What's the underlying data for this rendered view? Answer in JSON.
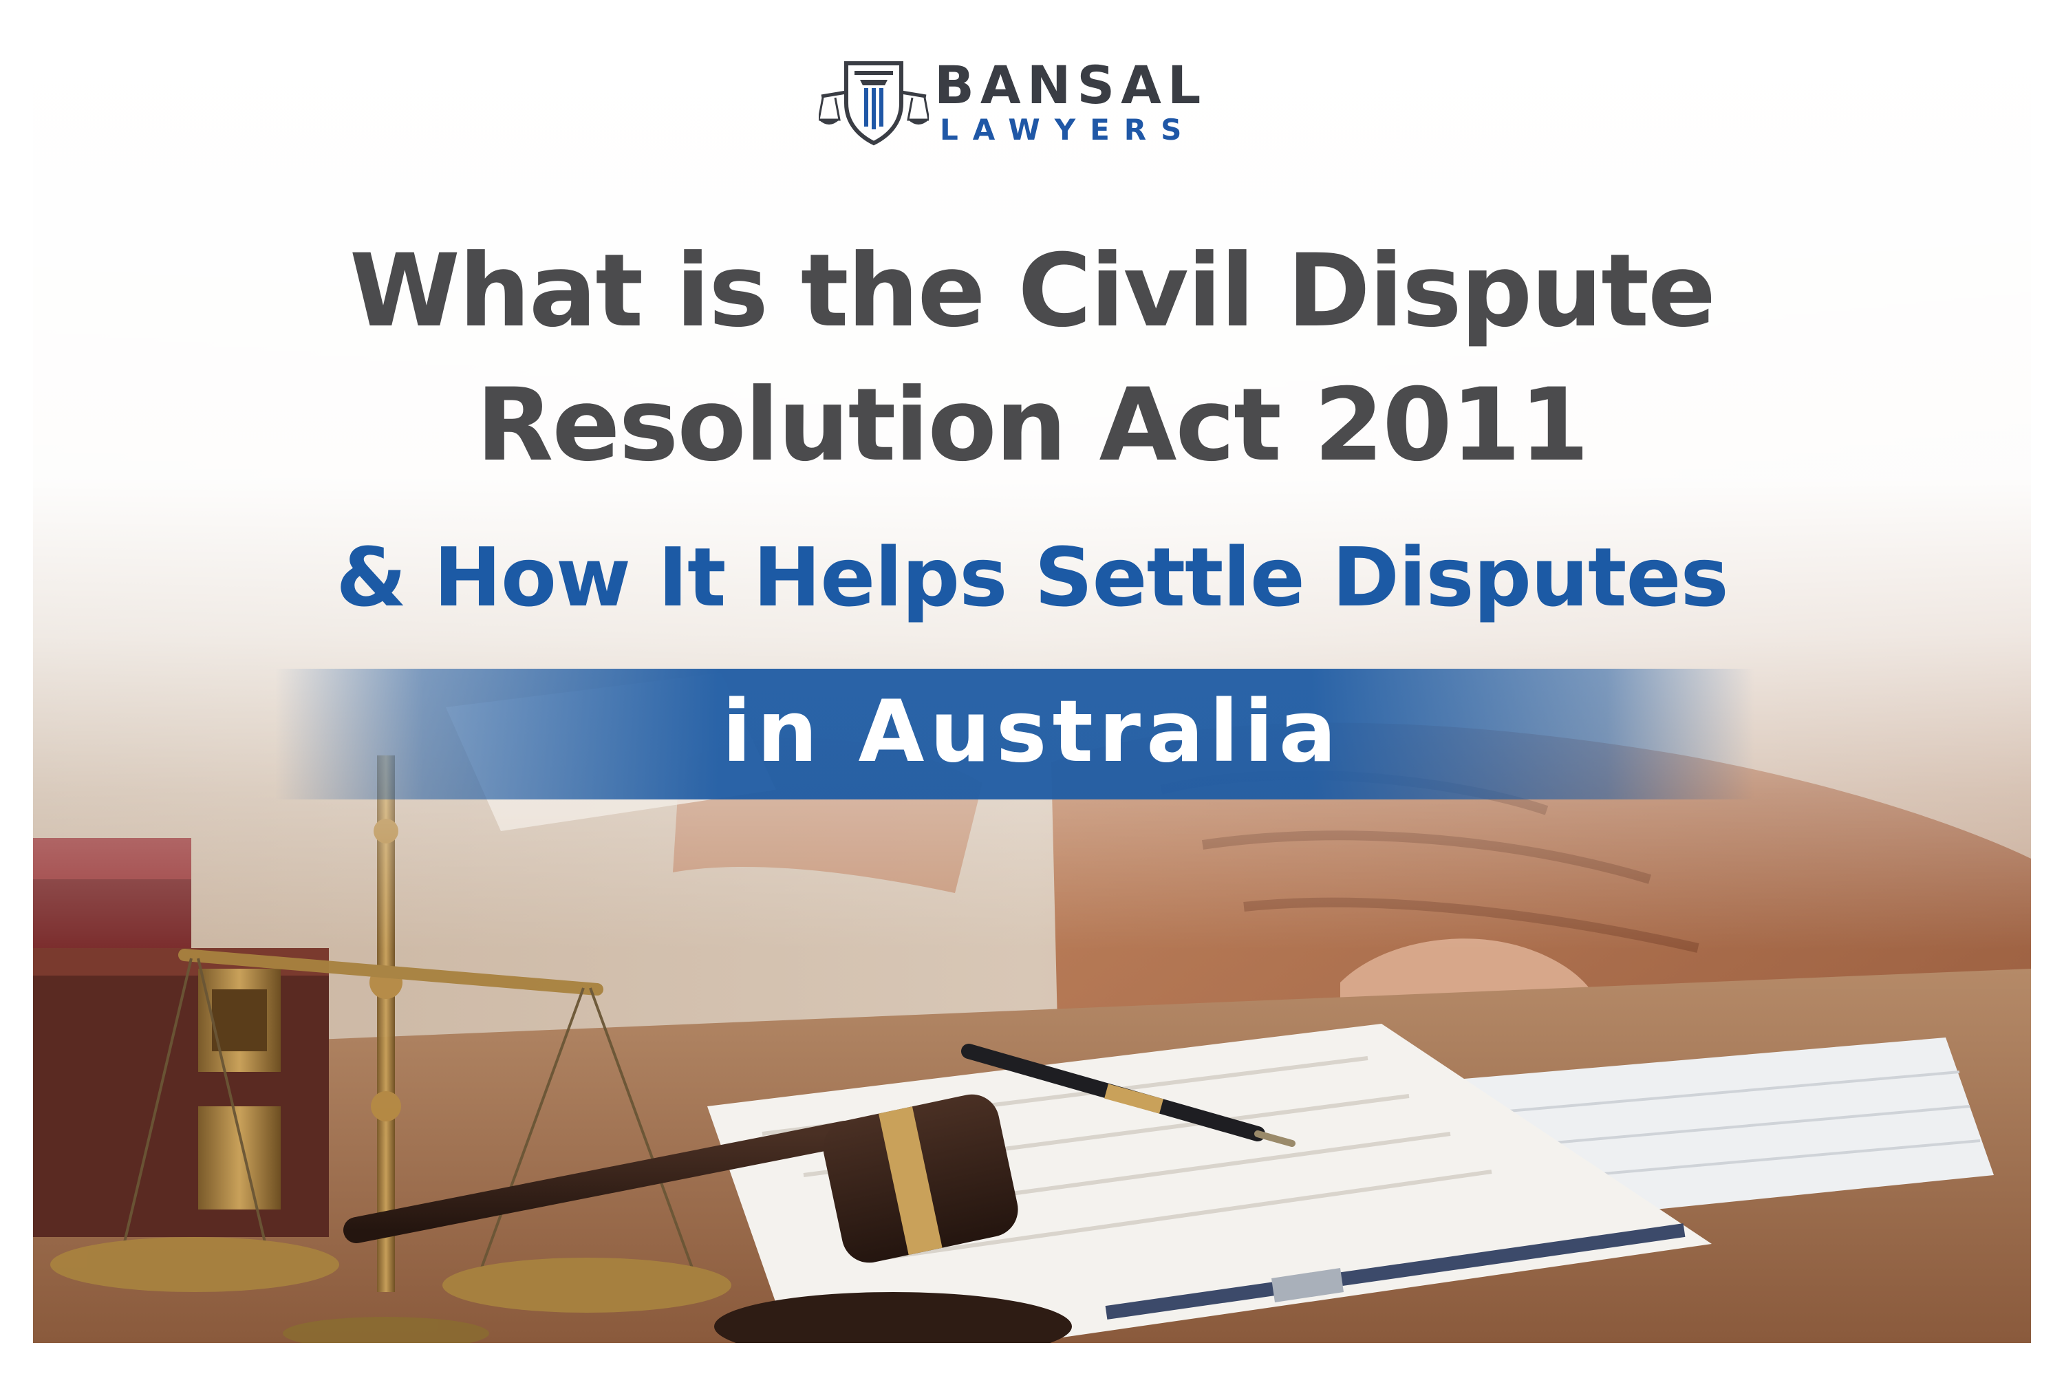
{
  "logo": {
    "name": "BANSAL",
    "subtitle": "LAWYERS",
    "icon": "scales-of-justice-shield-icon"
  },
  "headline": {
    "line1": "What is the Civil Dispute",
    "line2": "Resolution Act 2011",
    "line3": "& How It Helps Settle Disputes",
    "banner": "in Australia"
  },
  "colors": {
    "title_text": "#4b4b4d",
    "accent_blue": "#1c5aa5",
    "banner_text": "#ffffff"
  },
  "background": {
    "scene": "legal desk with scales of justice, gavel, pen, documents and keyboard"
  }
}
